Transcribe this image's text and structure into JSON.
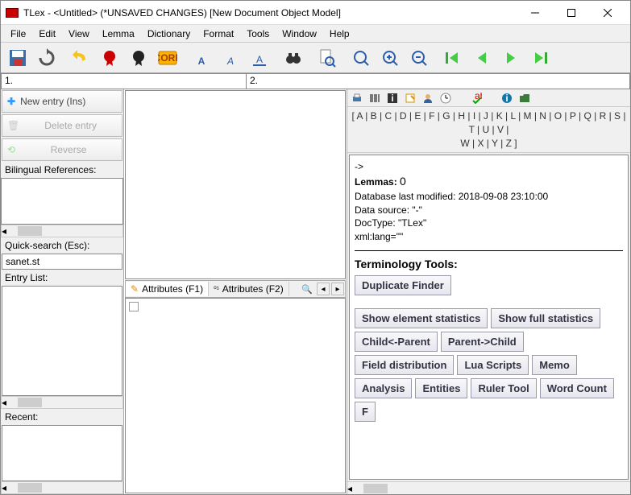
{
  "titlebar": {
    "title": "TLex - <Untitled> (*UNSAVED CHANGES) [New Document Object Model]"
  },
  "menubar": [
    "File",
    "Edit",
    "View",
    "Lemma",
    "Dictionary",
    "Format",
    "Tools",
    "Window",
    "Help"
  ],
  "addressbar": {
    "tab1": "1.",
    "tab2": "2."
  },
  "left": {
    "new_entry": "New entry (Ins)",
    "delete_entry": "Delete entry",
    "reverse": "Reverse",
    "biling_label": "Bilingual References:",
    "quicksearch_label": "Quick-search (Esc):",
    "quicksearch_value": "sanet.st",
    "entrylist_label": "Entry List:",
    "recent_label": "Recent:"
  },
  "attributes": {
    "tab1": "Attributes (F1)",
    "tab2": "Attributes (F2)"
  },
  "right": {
    "alpha_row1": "[ A | B | C | D | E | F | G | H | I | J | K | L | M | N | O | P | Q | R | S | T | U | V |",
    "alpha_row2": "W | X | Y | Z ]",
    "arrow": "->",
    "lemmas_label": "Lemmas:",
    "lemmas_count": "0",
    "db_modified": "Database last modified: 2018-09-08 23:10:00",
    "data_source": "Data source: \"-\"",
    "doctype": "DocType: \"TLex\"",
    "xmllang": "xml:lang=\"\"",
    "term_title": "Terminology Tools:",
    "buttons": [
      "Duplicate Finder",
      "Show element statistics",
      "Show full statistics",
      "Child<-Parent",
      "Parent->Child",
      "Field distribution",
      "Lua Scripts",
      "Memo",
      "Analysis",
      "Entities",
      "Ruler Tool",
      "Word Count",
      "F"
    ]
  }
}
